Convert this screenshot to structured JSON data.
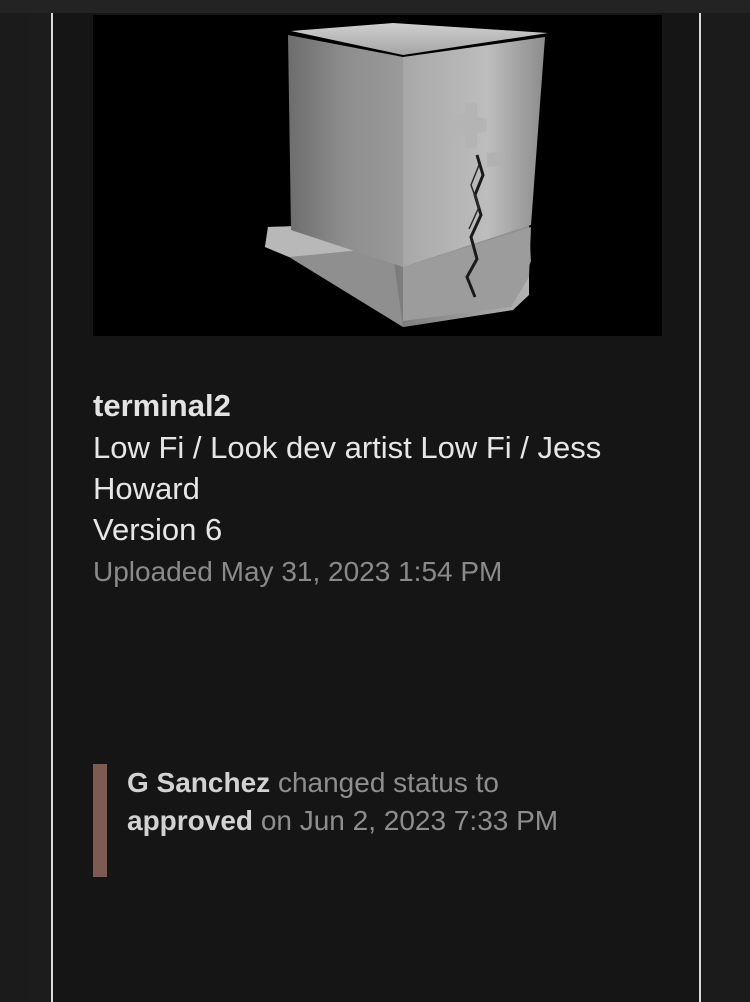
{
  "asset": {
    "title": "terminal2",
    "path_line1": "Low Fi / Look dev artist Low Fi / Jess",
    "path_line2": "Howard",
    "version": "Version 6",
    "uploaded": "Uploaded May 31, 2023 1:54 PM",
    "thumbnail_icon": "3d-render-terminal-block"
  },
  "activity": {
    "user": "G Sanchez",
    "action": "changed status to",
    "status": "approved",
    "when": "on Jun 2, 2023 7:33 PM",
    "accent_color": "#7d5b50"
  }
}
